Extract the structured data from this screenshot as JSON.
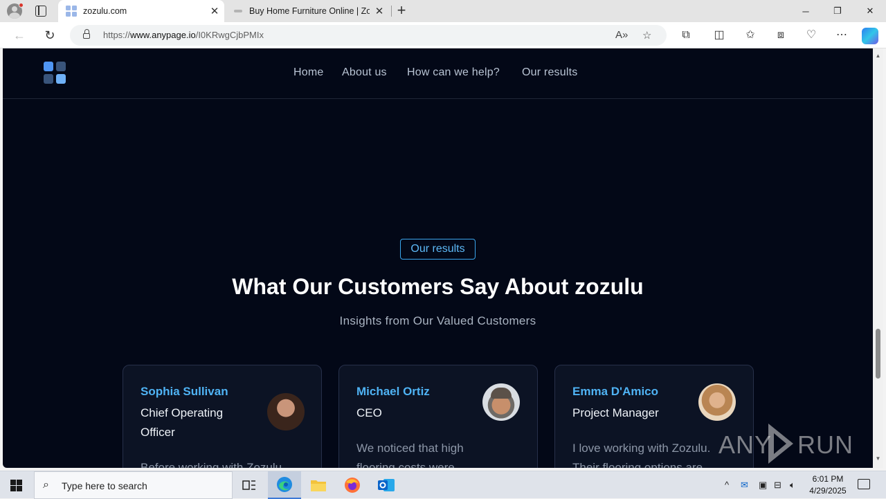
{
  "browser": {
    "tabs": [
      {
        "title": "zozulu.com",
        "active": true
      },
      {
        "title": "Buy Home Furniture Online | Zozulu",
        "active": false
      }
    ],
    "url_prefix": "https://",
    "url_host": "www.anypage.io",
    "url_path": "/I0KRwgCjbPMIx",
    "window_buttons": {
      "minimize": "─",
      "restore": "❐",
      "close": "✕"
    }
  },
  "site": {
    "nav": [
      "Home",
      "About us",
      "How can we help?",
      "Our results"
    ],
    "badge": "Our results",
    "headline": "What Our Customers Say About zozulu",
    "subheadline": "Insights from Our Valued Customers",
    "testimonials": [
      {
        "name": "Sophia Sullivan",
        "role": "Chief Operating Officer",
        "quote": "Before working with Zozulu"
      },
      {
        "name": "Michael Ortiz",
        "role": "CEO",
        "quote": "We noticed that high flooring costs were"
      },
      {
        "name": "Emma D'Amico",
        "role": "Project Manager",
        "quote": "I love working with Zozulu. Their flooring options are"
      }
    ]
  },
  "watermark": "ANY RUN",
  "taskbar": {
    "search_placeholder": "Type here to search",
    "time": "6:01 PM",
    "date": "4/29/2025"
  },
  "colors": {
    "page_bg": "#030817",
    "accent": "#4fb3f4",
    "card_bg": "#0c1324"
  }
}
